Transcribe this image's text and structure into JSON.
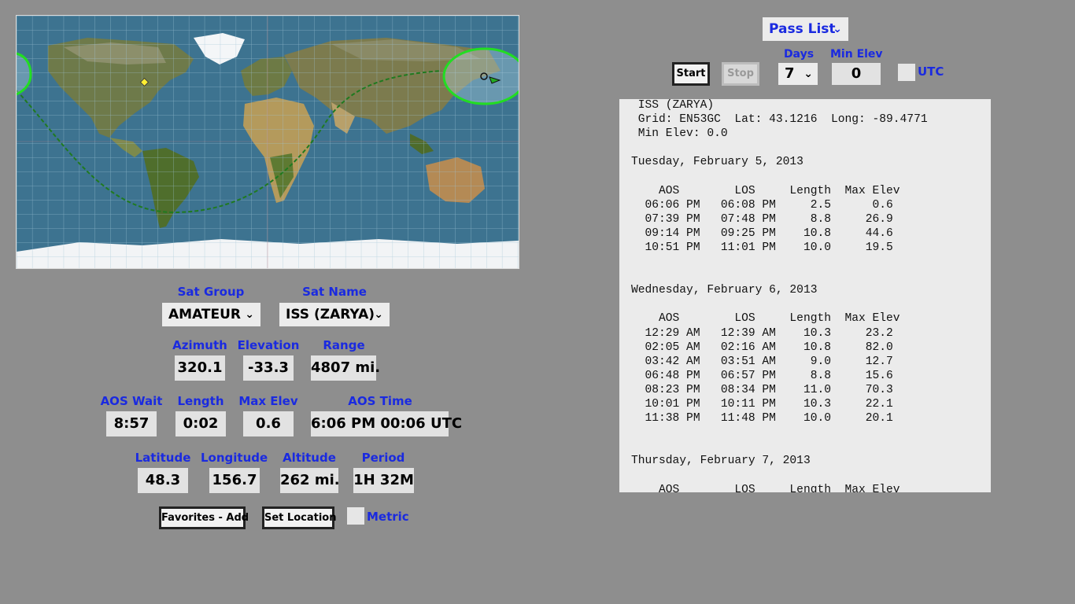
{
  "header": {
    "view_select": "Pass List",
    "start_label": "Start",
    "stop_label": "Stop",
    "days_label": "Days",
    "days_value": "7",
    "min_elev_label": "Min Elev",
    "min_elev_value": "0",
    "utc_label": "UTC"
  },
  "selection": {
    "sat_group_label": "Sat Group",
    "sat_group_value": "AMATEUR",
    "sat_name_label": "Sat Name",
    "sat_name_value": "ISS (ZARYA)"
  },
  "readouts": {
    "azimuth_label": "Azimuth",
    "azimuth": "320.1",
    "elevation_label": "Elevation",
    "elevation": "-33.3",
    "range_label": "Range",
    "range": "4807 mi.",
    "aos_wait_label": "AOS Wait",
    "aos_wait": "8:57",
    "length_label": "Length",
    "length": "0:02",
    "max_elev_label": "Max Elev",
    "max_elev": "0.6",
    "aos_time_label": "AOS Time",
    "aos_time": "6:06 PM  00:06 UTC",
    "latitude_label": "Latitude",
    "latitude": "48.3",
    "longitude_label": "Longitude",
    "longitude": "156.7",
    "altitude_label": "Altitude",
    "altitude": "262 mi.",
    "period_label": "Period",
    "period": "1H 32M"
  },
  "actions": {
    "favorites_add_label": "Favorites - Add",
    "set_location_label": "Set Location",
    "metric_label": "Metric"
  },
  "colors": {
    "label_blue": "#1a2ae0",
    "footprint_green": "#22dd22",
    "ground_track": "#1f7a1f"
  },
  "pass_list": {
    "text": " ISS (ZARYA)\n Grid: EN53GC  Lat: 43.1216  Long: -89.4771\n Min Elev: 0.0\n\nTuesday, February 5, 2013\n\n    AOS        LOS     Length  Max Elev\n  06:06 PM   06:08 PM     2.5      0.6\n  07:39 PM   07:48 PM     8.8     26.9\n  09:14 PM   09:25 PM    10.8     44.6\n  10:51 PM   11:01 PM    10.0     19.5\n\n\nWednesday, February 6, 2013\n\n    AOS        LOS     Length  Max Elev\n  12:29 AM   12:39 AM    10.3     23.2\n  02:05 AM   02:16 AM    10.8     82.0\n  03:42 AM   03:51 AM     9.0     12.7\n  06:48 PM   06:57 PM     8.8     15.6\n  08:23 PM   08:34 PM    11.0     70.3\n  10:01 PM   10:11 PM    10.3     22.1\n  11:38 PM   11:48 PM    10.0     20.1\n\n\nThursday, February 7, 2013\n\n    AOS        LOS     Length  Max Elev"
  }
}
